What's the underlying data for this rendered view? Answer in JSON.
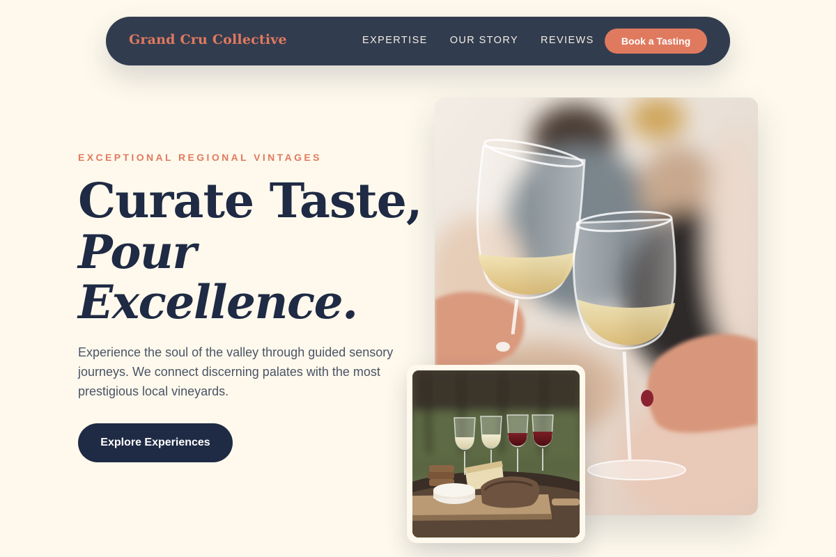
{
  "nav": {
    "brand": "Grand Cru Collective",
    "links": [
      {
        "label": "EXPERTISE"
      },
      {
        "label": "OUR STORY"
      },
      {
        "label": "REVIEWS"
      }
    ],
    "cta_label": "Book a Tasting"
  },
  "hero": {
    "eyebrow": "EXCEPTIONAL REGIONAL VINTAGES",
    "headline_line1": "Curate Taste,",
    "headline_line2": "Pour",
    "headline_line3": "Excellence.",
    "body": "Experience the soul of the valley through guided sensory journeys. We connect discerning palates with the most prestigious local vineyards.",
    "cta_label": "Explore Experiences"
  },
  "images": {
    "main_photo_icon": "wine-glasses-toast-photo-icon",
    "inset_photo_icon": "wine-flight-cheese-board-photo-icon"
  },
  "colors": {
    "background": "#fef9ec",
    "nav_background": "#323c4f",
    "accent": "#e07a5f",
    "navy": "#1f2a44",
    "body_text": "#4a5366"
  }
}
